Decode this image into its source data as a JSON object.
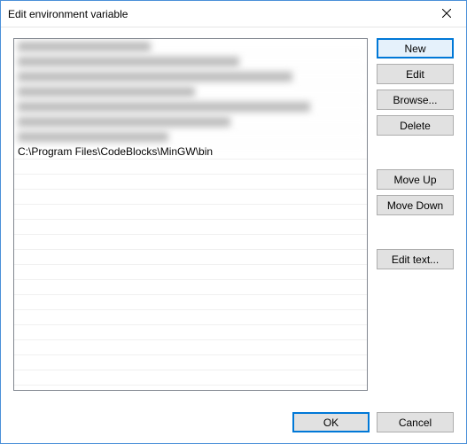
{
  "window": {
    "title": "Edit environment variable"
  },
  "list": {
    "rows": [
      {
        "text": "",
        "blurred": true
      },
      {
        "text": "",
        "blurred": true
      },
      {
        "text": "",
        "blurred": true
      },
      {
        "text": "",
        "blurred": true
      },
      {
        "text": "",
        "blurred": true
      },
      {
        "text": "",
        "blurred": true
      },
      {
        "text": "",
        "blurred": true
      },
      {
        "text": "C:\\Program Files\\CodeBlocks\\MinGW\\bin",
        "blurred": false
      }
    ]
  },
  "buttons": {
    "new": "New",
    "edit": "Edit",
    "browse": "Browse...",
    "delete": "Delete",
    "move_up": "Move Up",
    "move_down": "Move Down",
    "edit_text": "Edit text...",
    "ok": "OK",
    "cancel": "Cancel"
  }
}
